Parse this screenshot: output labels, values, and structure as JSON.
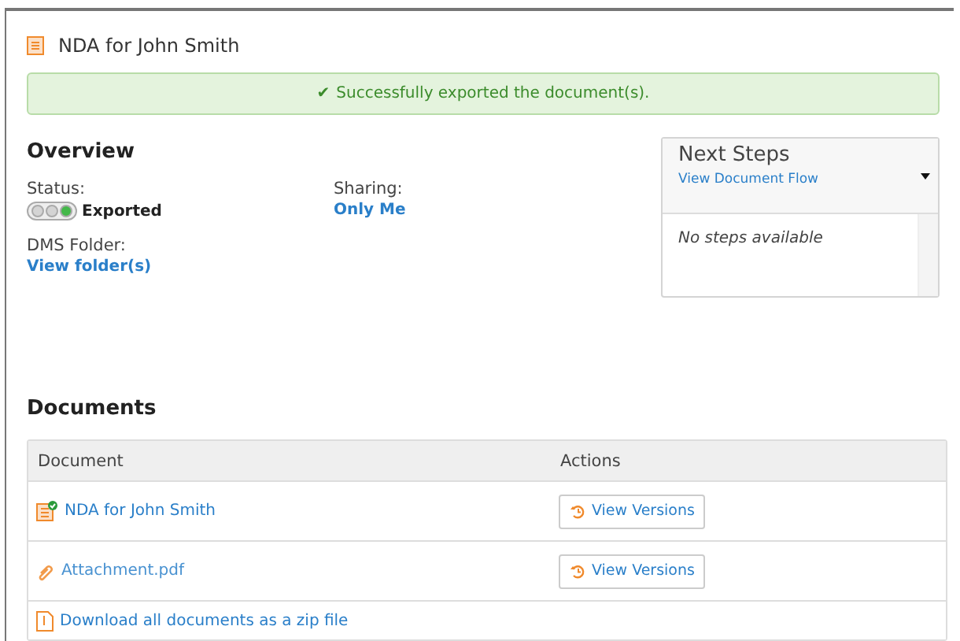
{
  "header": {
    "title": "NDA for John Smith"
  },
  "alert": {
    "icon": "✔",
    "message": "Successfully exported the document(s)."
  },
  "overview": {
    "heading": "Overview",
    "status": {
      "label": "Status:",
      "lights": [
        {
          "on": false
        },
        {
          "on": false
        },
        {
          "on": true
        }
      ],
      "value": "Exported"
    },
    "sharing": {
      "label": "Sharing:",
      "value": "Only Me"
    },
    "dms_folder": {
      "label": "DMS Folder:",
      "value": "View folder(s)"
    }
  },
  "next_steps": {
    "title": "Next Steps",
    "link": "View Document Flow",
    "empty_text": "No steps available"
  },
  "documents": {
    "heading": "Documents",
    "columns": [
      "Document",
      "Actions"
    ],
    "rows": [
      {
        "kind": "document",
        "exported": true,
        "name": "NDA for John Smith",
        "action": "View Versions"
      },
      {
        "kind": "attachment",
        "exported": false,
        "name": "Attachment.pdf",
        "action": "View Versions"
      }
    ],
    "footer_link": "Download all documents as a zip file"
  }
}
